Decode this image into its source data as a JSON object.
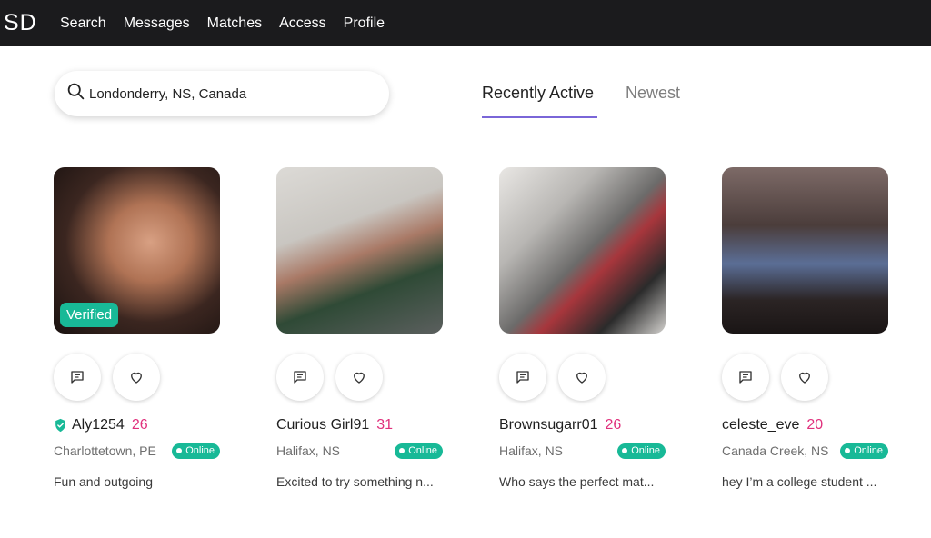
{
  "header": {
    "logo": "SD",
    "nav": [
      "Search",
      "Messages",
      "Matches",
      "Access",
      "Profile"
    ]
  },
  "search": {
    "value": "Londonderry, NS, Canada",
    "icon": "search-icon"
  },
  "tabs": [
    {
      "label": "Recently Active",
      "active": true
    },
    {
      "label": "Newest",
      "active": false
    }
  ],
  "colors": {
    "accent": "#7a66d8",
    "age": "#e0307c",
    "online": "#18b997",
    "topbar": "#1b1b1d"
  },
  "profiles": [
    {
      "name": "Aly1254",
      "age": "26",
      "location": "Charlottetown, PE",
      "status": "Online",
      "bio": "Fun and outgoing",
      "verified": true,
      "badge": "Verified"
    },
    {
      "name": "Curious Girl91",
      "age": "31",
      "location": "Halifax, NS",
      "status": "Online",
      "bio": "Excited to try something n...",
      "verified": false
    },
    {
      "name": "Brownsugarr01",
      "age": "26",
      "location": "Halifax, NS",
      "status": "Online",
      "bio": "Who says the perfect mat...",
      "verified": false
    },
    {
      "name": "celeste_eve",
      "age": "20",
      "location": "Canada Creek, NS",
      "status": "Online",
      "bio": "hey I’m a college student ...",
      "verified": false
    }
  ]
}
